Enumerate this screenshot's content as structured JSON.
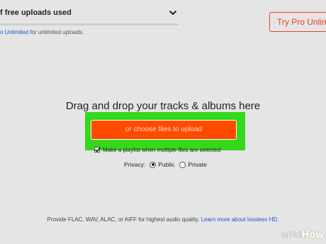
{
  "upload_quota": {
    "title": "f free uploads used",
    "upgrade_link": "o Unlimited",
    "upgrade_suffix": " for unlimited uploads.",
    "progress_fraction": 0.0
  },
  "header": {
    "try_pro_label": "Try Pro Unlimit"
  },
  "dropzone": {
    "heading": "Drag and drop your tracks & albums here",
    "choose_files_label": "or choose files to upload",
    "playlist_checkbox_label": "Make a playlist when multiple files are selected",
    "playlist_checked": true
  },
  "privacy": {
    "label": "Privacy:",
    "options": [
      {
        "label": "Public",
        "selected": true
      },
      {
        "label": "Private",
        "selected": false
      }
    ]
  },
  "footer": {
    "note": "Provide FLAC, WAV, ALAC, or AIFF for highest audio quality. ",
    "link": "Learn more about lossless HD."
  },
  "watermark": {
    "wiki": "wiki",
    "how": "How"
  },
  "colors": {
    "accent_orange": "#ff4a00",
    "highlight_green": "#35d81a",
    "pro_red": "#e8412a",
    "link_blue": "#1a54d8"
  },
  "icons": {
    "dropdown": "chevron-down-icon",
    "checkbox": "checkmark-icon"
  }
}
